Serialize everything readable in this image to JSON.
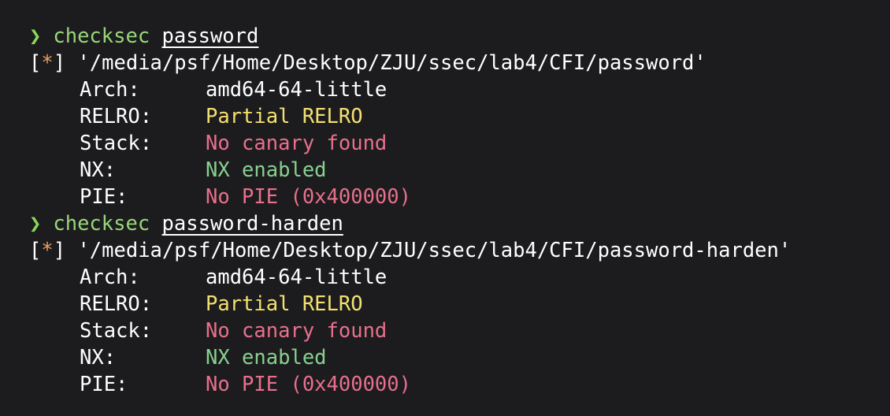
{
  "colors": {
    "background": "#1c1c1e",
    "prompt": "#8ad95a",
    "command": "#98d67a",
    "info_star": "#f0a060",
    "partial": "#f5e070",
    "bad": "#e8708c",
    "good": "#88d090"
  },
  "prompt_symbol": "❯",
  "blocks": [
    {
      "command": "checksec",
      "argument": "password",
      "info_open": "[",
      "info_star": "*",
      "info_close": "]",
      "path": "'/media/psf/Home/Desktop/ZJU/ssec/lab4/CFI/password'",
      "rows": [
        {
          "label": "Arch:",
          "value": "amd64-64-little"
        },
        {
          "label": "RELRO:",
          "value": "Partial RELRO"
        },
        {
          "label": "Stack:",
          "value": "No canary found"
        },
        {
          "label": "NX:",
          "value": "NX enabled"
        },
        {
          "label": "PIE:",
          "value": "No PIE (0x400000)"
        }
      ]
    },
    {
      "command": "checksec",
      "argument": "password-harden",
      "info_open": "[",
      "info_star": "*",
      "info_close": "]",
      "path": "'/media/psf/Home/Desktop/ZJU/ssec/lab4/CFI/password-harden'",
      "rows": [
        {
          "label": "Arch:",
          "value": "amd64-64-little"
        },
        {
          "label": "RELRO:",
          "value": "Partial RELRO"
        },
        {
          "label": "Stack:",
          "value": "No canary found"
        },
        {
          "label": "NX:",
          "value": "NX enabled"
        },
        {
          "label": "PIE:",
          "value": "No PIE (0x400000)"
        }
      ]
    }
  ]
}
